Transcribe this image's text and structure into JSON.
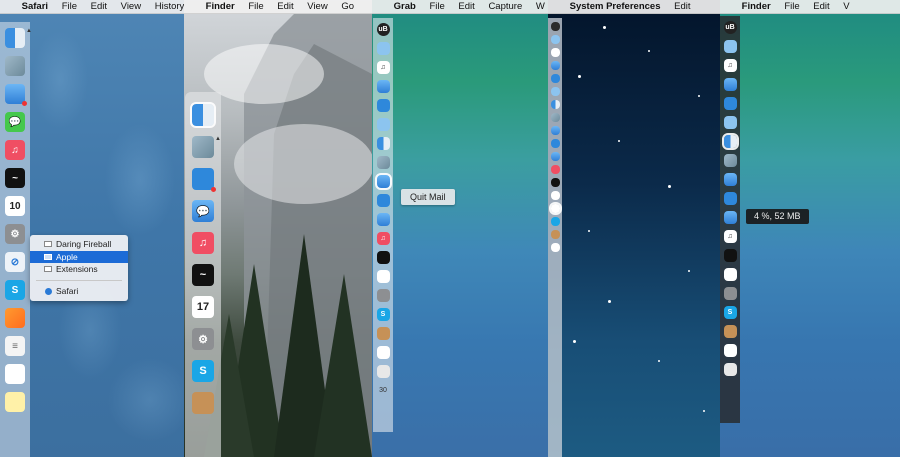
{
  "panels": [
    {
      "menubar": {
        "app": "Safari",
        "items": [
          "File",
          "Edit",
          "View",
          "History"
        ]
      }
    },
    {
      "menubar": {
        "app": "Finder",
        "items": [
          "File",
          "Edit",
          "View",
          "Go"
        ]
      }
    },
    {
      "menubar": {
        "app": "Grab",
        "items": [
          "File",
          "Edit",
          "Capture",
          "W"
        ]
      }
    },
    {
      "menubar": {
        "app": "System Preferences",
        "items": [
          "Edit"
        ]
      }
    },
    {
      "menubar": {
        "app": "Finder",
        "items": [
          "File",
          "Edit",
          "V"
        ]
      }
    }
  ],
  "safari_menu": {
    "windows": [
      "Daring Fireball",
      "Apple",
      "Extensions"
    ],
    "selected": "Apple",
    "app_item": "Safari"
  },
  "dock1": {
    "calendar_day": "10"
  },
  "dock2": {
    "calendar_day": "17"
  },
  "dock3": {
    "tooltip": "Quit Mail",
    "bottom_number": "30",
    "top_icon": "uB"
  },
  "dock5": {
    "tooltip": "4 %, 52 MB",
    "top_icon": "uB"
  },
  "apple_symbol": ""
}
